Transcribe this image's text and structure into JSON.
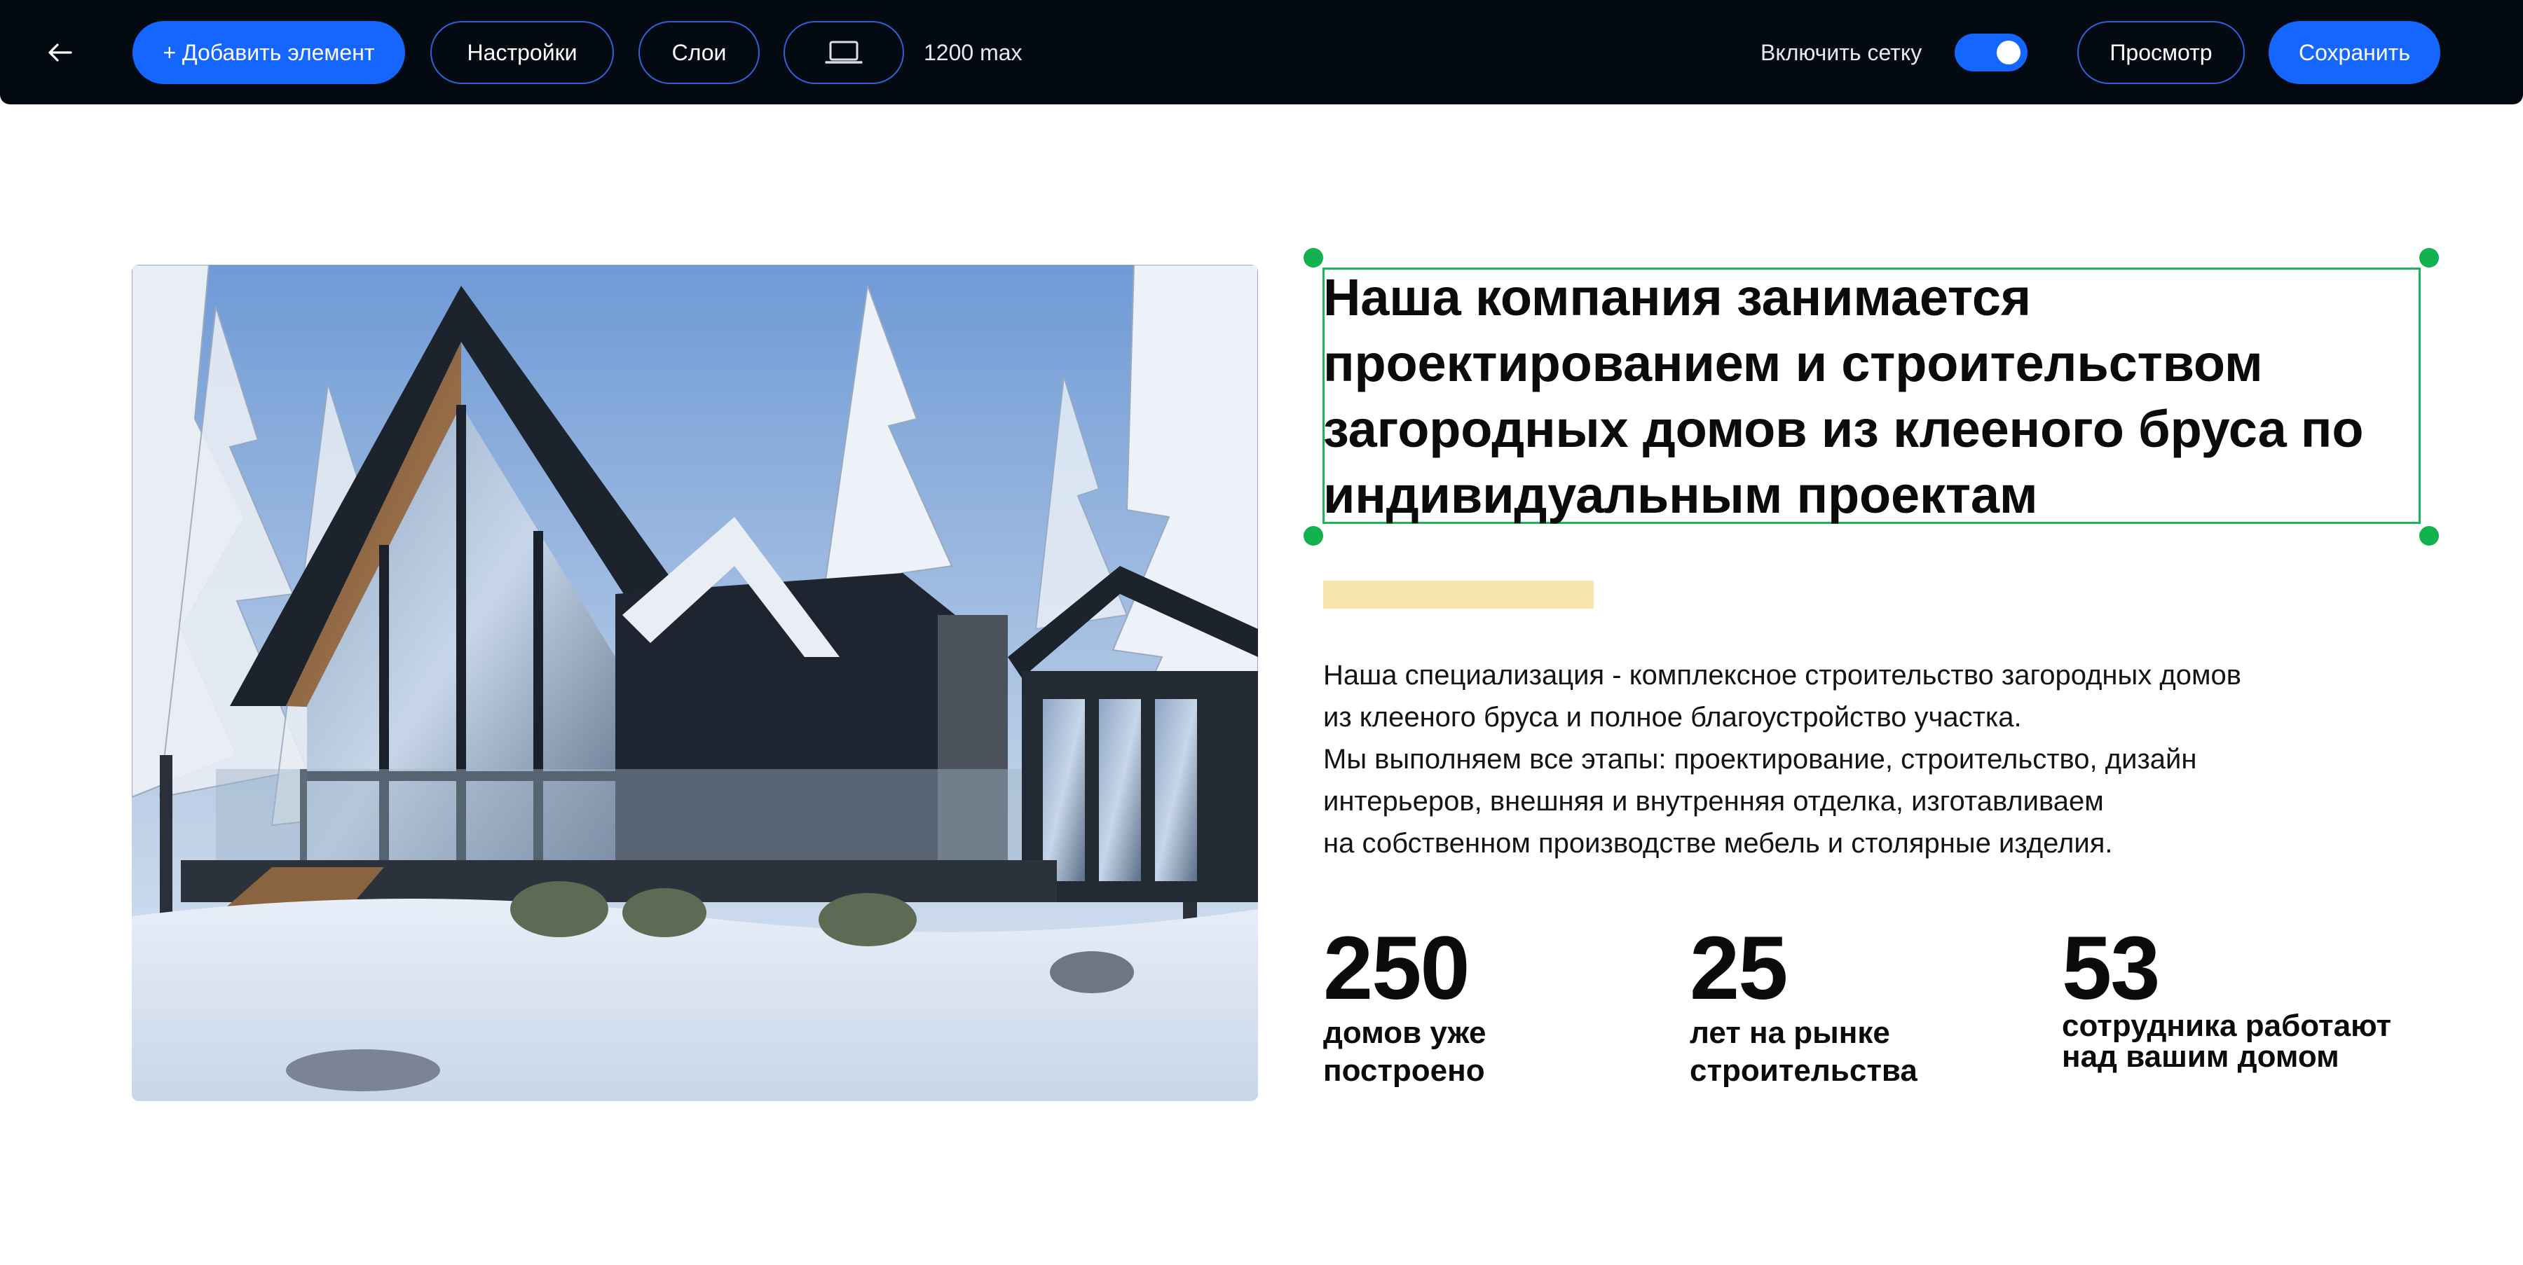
{
  "toolbar": {
    "back_icon": "arrow-left-icon",
    "add_label": "+ Добавить элемент",
    "settings_label": "Настройки",
    "layers_label": "Слои",
    "device_icon": "laptop-icon",
    "width_label": "1200 max",
    "grid_label": "Включить сетку",
    "grid_enabled": true,
    "preview_label": "Просмотр",
    "save_label": "Сохранить",
    "colors": {
      "background": "#030a12",
      "primary": "#1466ff",
      "outline": "#2e61d6"
    }
  },
  "content": {
    "heading": "Наша компания занимается проектированием и строительством загородных домов из клееного бруса по индивидуальным проектам",
    "description_lines": [
      "Наша специализация - комплексное строительство загородных домов",
      "из клееного бруса и полное благоустройство участка.",
      "Мы выполняем все этапы: проектирование, строительство, дизайн",
      "интерьеров, внешняя и внутренняя отделка, изготавливаем",
      "на собственном производстве мебель и столярные изделия."
    ],
    "stats": [
      {
        "number": "250",
        "label_lines": [
          "домов уже",
          "построено"
        ]
      },
      {
        "number": "25",
        "label_lines": [
          "лет на рынке",
          "строительства"
        ]
      },
      {
        "number": "53",
        "label_lines": [
          "сотрудника работают",
          "над вашим домом"
        ]
      }
    ],
    "colors": {
      "selection": "#1fb45a",
      "accent_bar": "#f7e6ae",
      "text": "#0b0b0b"
    }
  }
}
